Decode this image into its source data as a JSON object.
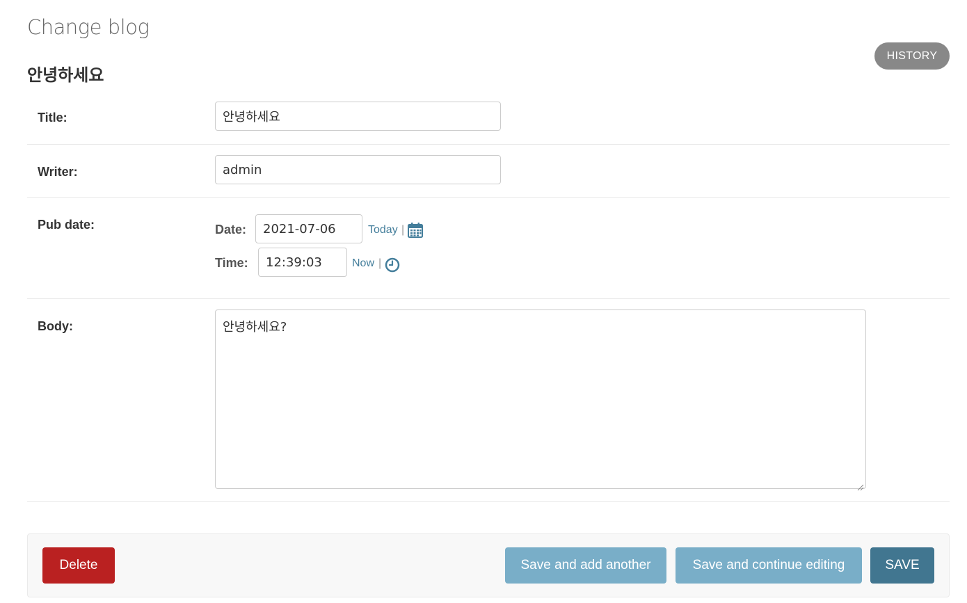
{
  "page": {
    "heading": "Change blog",
    "object_title": "안녕하세요",
    "history_label": "History"
  },
  "fields": {
    "title": {
      "label": "Title:",
      "value": "안녕하세요"
    },
    "writer": {
      "label": "Writer:",
      "value": "admin"
    },
    "pub_date": {
      "label": "Pub date:",
      "date_label": "Date:",
      "date_value": "2021-07-06",
      "today_link": "Today",
      "time_label": "Time:",
      "time_value": "12:39:03",
      "now_link": "Now",
      "separator": "|"
    },
    "body": {
      "label": "Body:",
      "value": "안녕하세요?"
    }
  },
  "actions": {
    "delete_label": "Delete",
    "save_add_another_label": "Save and add another",
    "save_continue_label": "Save and continue editing",
    "save_label": "Save"
  },
  "colors": {
    "link": "#447e9b",
    "delete": "#ba2121",
    "secondary_button": "#79aec8",
    "primary_button": "#417690",
    "history_button": "#888888"
  },
  "icons": {
    "calendar": "calendar-icon",
    "clock": "clock-icon"
  }
}
